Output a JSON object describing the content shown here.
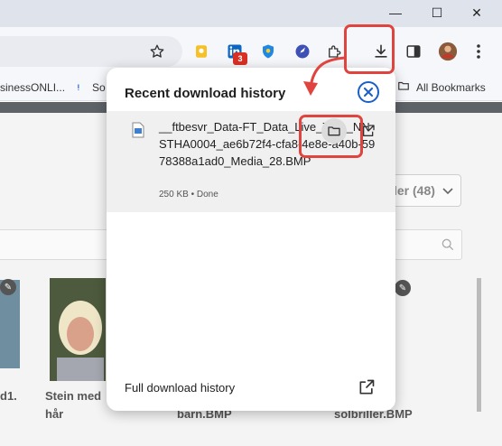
{
  "window": {
    "minimize_glyph": "—",
    "maximize_glyph": "☐",
    "close_glyph": "✕"
  },
  "toolbar": {
    "icons": [
      "star-icon",
      "keep-icon",
      "linkedin-icon",
      "shield-extension-icon",
      "rocket-extension-icon",
      "extensions-icon",
      "download-icon",
      "side-panel-icon",
      "profile-avatar",
      "menu-icon"
    ],
    "linkedin_badge": "3"
  },
  "bookmarks_bar": {
    "items": [
      "sinessONLI...",
      "So"
    ],
    "all_bookmarks": "All Bookmarks"
  },
  "page": {
    "filter_label": "ler (48)",
    "captions": [
      {
        "line1": "d1.",
        "line2": ""
      },
      {
        "line1": "Stein med",
        "line2": "hår"
      },
      {
        "line1": "",
        "line2": "barn.BMP"
      },
      {
        "line1": "",
        "line2": "solbriller.BMP"
      }
    ]
  },
  "download_popup": {
    "title": "Recent download history",
    "item": {
      "file_name": "__ftbesvr_Data-FT_Data_Live_Tree_NNSTHA0004_ae6b72f4-cfa8-4e8e-a40b-5978388a1ad0_Media_28.BMP",
      "size": "250 KB",
      "status": "Done",
      "separator": " • "
    },
    "full_history": "Full download history"
  },
  "colors": {
    "accent": "#1a5fc8",
    "annotation": "#e0443e"
  }
}
